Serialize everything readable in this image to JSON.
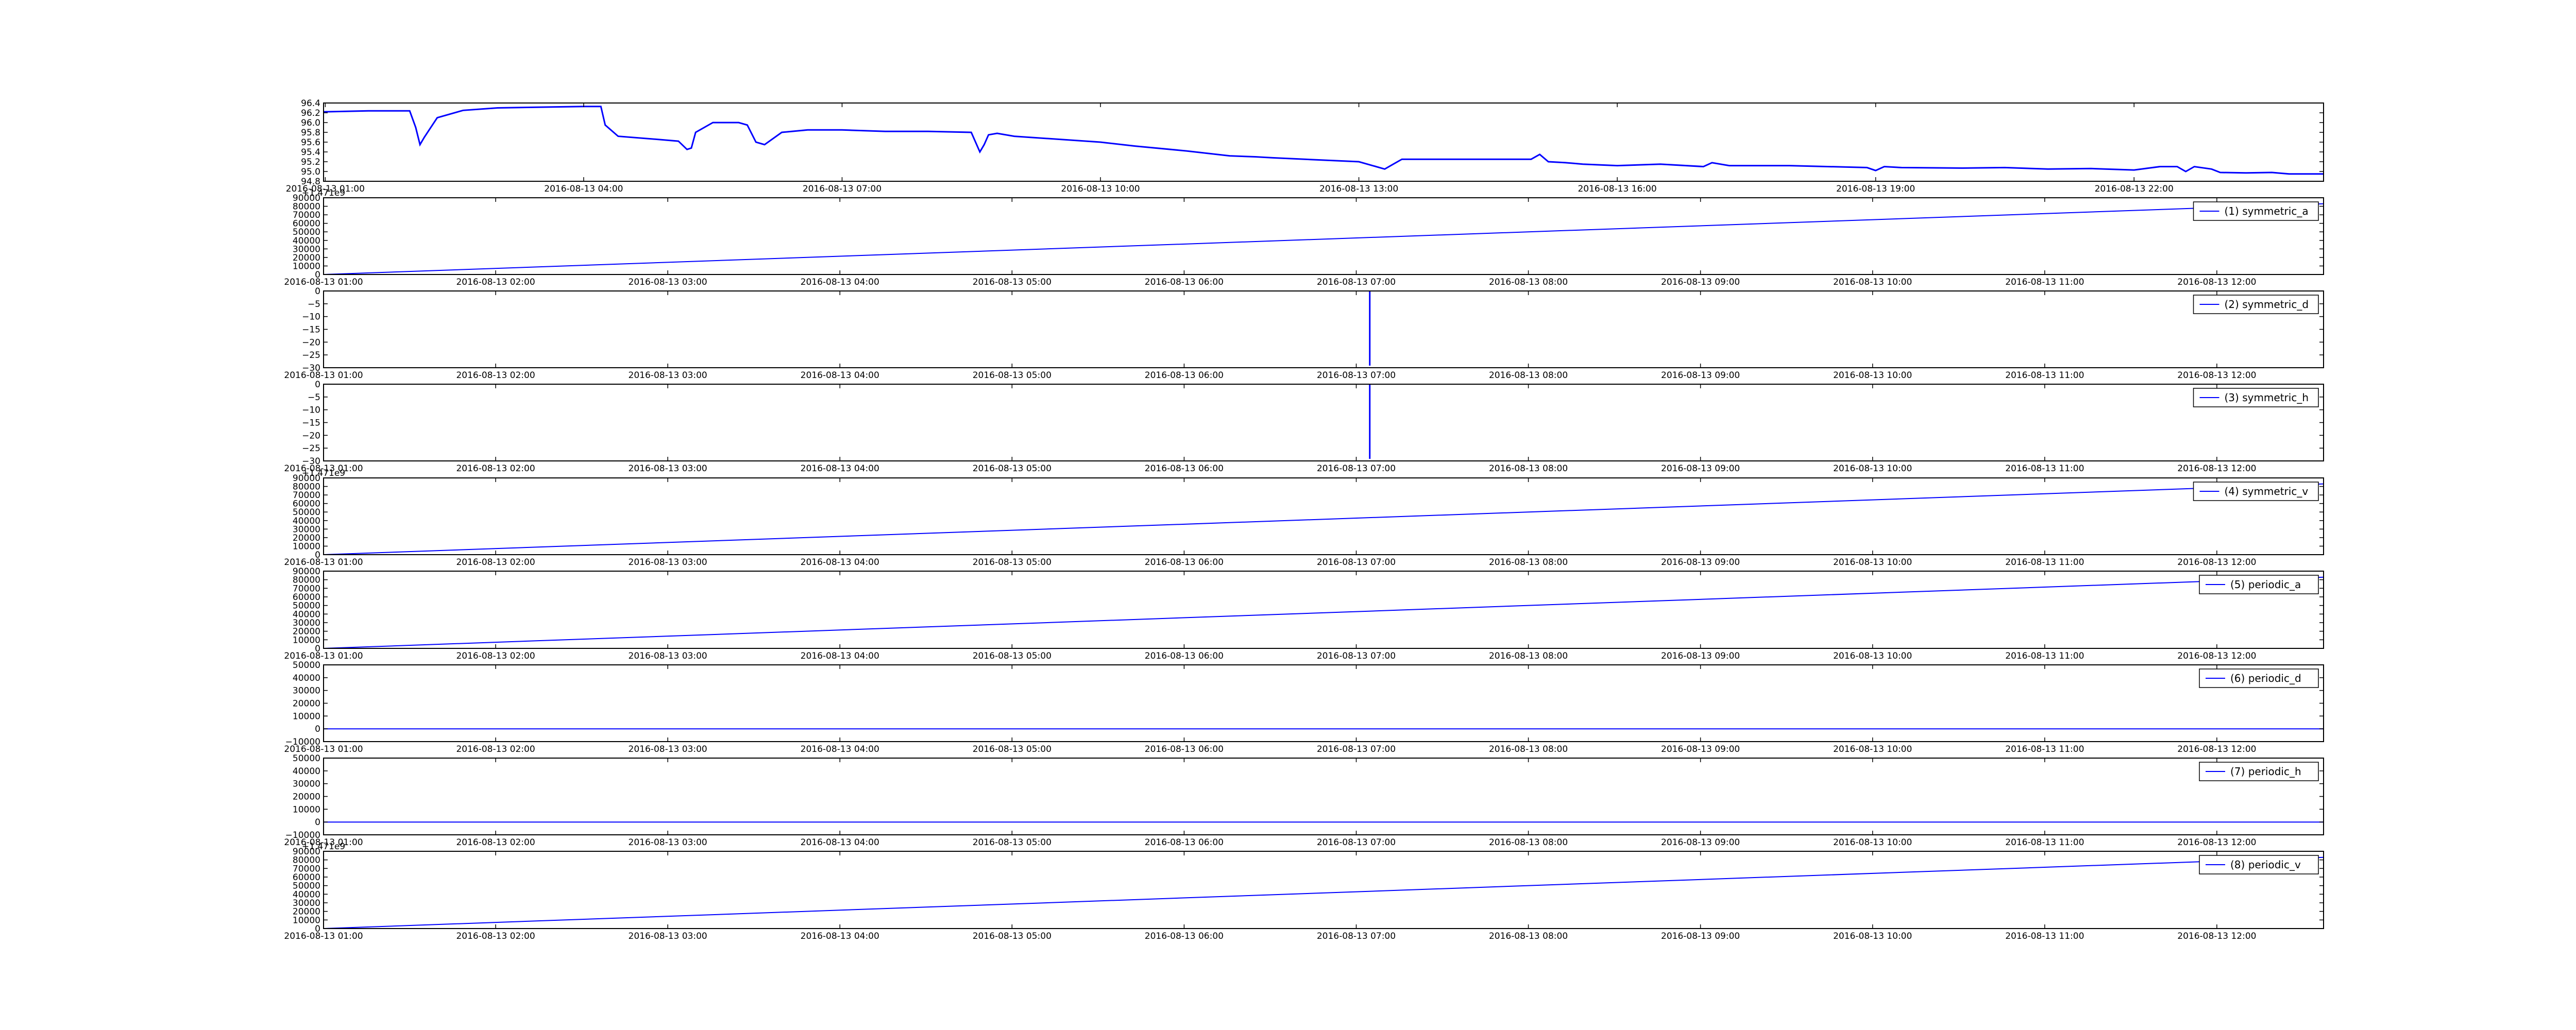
{
  "figure": {
    "background": "#ffffff",
    "line_color": "#0000ff",
    "axis_color": "#000000"
  },
  "chart_data": [
    {
      "type": "line",
      "title": "",
      "xlabel": "",
      "ylabel": "",
      "x_ticks": [
        "2016-08-13 01:00",
        "2016-08-13 04:00",
        "2016-08-13 07:00",
        "2016-08-13 10:00",
        "2016-08-13 13:00",
        "2016-08-13 16:00",
        "2016-08-13 19:00",
        "2016-08-13 22:00"
      ],
      "x_tick_values": [
        1,
        4,
        7,
        10,
        13,
        16,
        19,
        22
      ],
      "xlim": [
        0.98,
        24.2
      ],
      "ylim": [
        94.8,
        96.4
      ],
      "y_ticks": [
        "94.8",
        "95.0",
        "95.2",
        "95.4",
        "95.6",
        "95.8",
        "96.0",
        "96.2",
        "96.4"
      ],
      "y_tick_values": [
        94.8,
        95.0,
        95.2,
        95.4,
        95.6,
        95.8,
        96.0,
        96.2,
        96.4
      ],
      "legend": null,
      "series": [
        {
          "x": [
            0.98,
            1.5,
            1.98,
            2.05,
            2.1,
            2.15,
            2.3,
            2.6,
            3.0,
            4.0,
            4.2,
            4.25,
            4.4,
            4.9,
            5.1,
            5.2,
            5.25,
            5.3,
            5.5,
            5.8,
            5.9,
            6.0,
            6.1,
            6.3,
            6.6,
            7.0,
            7.5,
            8.0,
            8.5,
            8.6,
            8.65,
            8.7,
            8.8,
            9.0,
            10.0,
            10.4,
            11.0,
            11.5,
            11.8,
            12.0,
            13.0,
            13.2,
            13.3,
            13.4,
            13.5,
            13.7,
            14.0,
            14.5,
            15.0,
            15.1,
            15.2,
            15.4,
            15.6,
            16.0,
            16.5,
            17.0,
            17.1,
            17.3,
            18.0,
            18.9,
            19.0,
            19.1,
            19.3,
            20.0,
            20.5,
            21.0,
            21.5,
            22.0,
            22.3,
            22.5,
            22.6,
            22.7,
            22.9,
            23.0,
            23.3,
            23.6,
            23.8,
            24.0,
            24.2
          ],
          "values": [
            96.22,
            96.24,
            96.24,
            95.9,
            95.55,
            95.7,
            96.1,
            96.25,
            96.3,
            96.33,
            96.33,
            95.95,
            95.72,
            95.65,
            95.62,
            95.45,
            95.48,
            95.8,
            96.0,
            96.0,
            95.95,
            95.6,
            95.55,
            95.8,
            95.85,
            95.85,
            95.82,
            95.82,
            95.8,
            95.4,
            95.55,
            95.75,
            95.78,
            95.72,
            95.6,
            95.52,
            95.42,
            95.32,
            95.3,
            95.28,
            95.2,
            95.1,
            95.05,
            95.15,
            95.25,
            95.25,
            95.25,
            95.25,
            95.25,
            95.35,
            95.2,
            95.18,
            95.15,
            95.12,
            95.15,
            95.1,
            95.18,
            95.12,
            95.12,
            95.08,
            95.02,
            95.1,
            95.08,
            95.07,
            95.08,
            95.05,
            95.06,
            95.03,
            95.1,
            95.1,
            95.0,
            95.1,
            95.05,
            94.98,
            94.97,
            94.98,
            94.95,
            94.95,
            94.95
          ]
        }
      ]
    },
    {
      "type": "line",
      "x_ticks": [
        "2016-08-13 01:00",
        "2016-08-13 02:00",
        "2016-08-13 03:00",
        "2016-08-13 04:00",
        "2016-08-13 05:00",
        "2016-08-13 06:00",
        "2016-08-13 07:00",
        "2016-08-13 08:00",
        "2016-08-13 09:00",
        "2016-08-13 10:00",
        "2016-08-13 11:00",
        "2016-08-13 12:00"
      ],
      "x_tick_values": [
        1,
        2,
        3,
        4,
        5,
        6,
        7,
        8,
        9,
        10,
        11,
        12
      ],
      "xlim": [
        1.0,
        12.62
      ],
      "ylim": [
        0,
        90000
      ],
      "y_ticks": [
        "0",
        "10000",
        "20000",
        "30000",
        "40000",
        "50000",
        "60000",
        "70000",
        "80000",
        "90000"
      ],
      "y_tick_values": [
        0,
        10000,
        20000,
        30000,
        40000,
        50000,
        60000,
        70000,
        80000,
        90000
      ],
      "offset_text": "+1.471e9",
      "legend": {
        "labels": [
          "(1) symmetric_a"
        ],
        "position": "top-right"
      },
      "series": [
        {
          "name": "(1) symmetric_a",
          "x": [
            1.0,
            12.62
          ],
          "values": [
            0,
            83000
          ]
        }
      ]
    },
    {
      "type": "line",
      "x_ticks": [
        "2016-08-13 01:00",
        "2016-08-13 02:00",
        "2016-08-13 03:00",
        "2016-08-13 04:00",
        "2016-08-13 05:00",
        "2016-08-13 06:00",
        "2016-08-13 07:00",
        "2016-08-13 08:00",
        "2016-08-13 09:00",
        "2016-08-13 10:00",
        "2016-08-13 11:00",
        "2016-08-13 12:00"
      ],
      "x_tick_values": [
        1,
        2,
        3,
        4,
        5,
        6,
        7,
        8,
        9,
        10,
        11,
        12
      ],
      "xlim": [
        1.0,
        12.62
      ],
      "ylim": [
        -30,
        0
      ],
      "y_ticks": [
        "0",
        "−5",
        "−10",
        "−15",
        "−20",
        "−25",
        "−30"
      ],
      "y_tick_values": [
        0,
        -5,
        -10,
        -15,
        -20,
        -25,
        -30
      ],
      "offset_text": "",
      "legend": {
        "labels": [
          "(2) symmetric_d"
        ],
        "position": "top-right"
      },
      "series": [
        {
          "name": "(2) symmetric_d",
          "x": [
            1.0,
            7.077,
            7.077,
            7.08,
            7.08,
            12.62
          ],
          "values": [
            0,
            0,
            -29,
            -29,
            0,
            0
          ]
        }
      ]
    },
    {
      "type": "line",
      "x_ticks": [
        "2016-08-13 01:00",
        "2016-08-13 02:00",
        "2016-08-13 03:00",
        "2016-08-13 04:00",
        "2016-08-13 05:00",
        "2016-08-13 06:00",
        "2016-08-13 07:00",
        "2016-08-13 08:00",
        "2016-08-13 09:00",
        "2016-08-13 10:00",
        "2016-08-13 11:00",
        "2016-08-13 12:00"
      ],
      "x_tick_values": [
        1,
        2,
        3,
        4,
        5,
        6,
        7,
        8,
        9,
        10,
        11,
        12
      ],
      "xlim": [
        1.0,
        12.62
      ],
      "ylim": [
        -30,
        0
      ],
      "y_ticks": [
        "0",
        "−5",
        "−10",
        "−15",
        "−20",
        "−25",
        "−30"
      ],
      "y_tick_values": [
        0,
        -5,
        -10,
        -15,
        -20,
        -25,
        -30
      ],
      "offset_text": "",
      "legend": {
        "labels": [
          "(3) symmetric_h"
        ],
        "position": "top-right"
      },
      "series": [
        {
          "name": "(3) symmetric_h",
          "x": [
            1.0,
            7.077,
            7.077,
            7.08,
            7.08,
            12.62
          ],
          "values": [
            0,
            0,
            -29,
            -29,
            0,
            0
          ]
        }
      ]
    },
    {
      "type": "line",
      "x_ticks": [
        "2016-08-13 01:00",
        "2016-08-13 02:00",
        "2016-08-13 03:00",
        "2016-08-13 04:00",
        "2016-08-13 05:00",
        "2016-08-13 06:00",
        "2016-08-13 07:00",
        "2016-08-13 08:00",
        "2016-08-13 09:00",
        "2016-08-13 10:00",
        "2016-08-13 11:00",
        "2016-08-13 12:00"
      ],
      "x_tick_values": [
        1,
        2,
        3,
        4,
        5,
        6,
        7,
        8,
        9,
        10,
        11,
        12
      ],
      "xlim": [
        1.0,
        12.62
      ],
      "ylim": [
        0,
        90000
      ],
      "y_ticks": [
        "0",
        "10000",
        "20000",
        "30000",
        "40000",
        "50000",
        "60000",
        "70000",
        "80000",
        "90000"
      ],
      "y_tick_values": [
        0,
        10000,
        20000,
        30000,
        40000,
        50000,
        60000,
        70000,
        80000,
        90000
      ],
      "offset_text": "+1.471e9",
      "legend": {
        "labels": [
          "(4) symmetric_v"
        ],
        "position": "top-right"
      },
      "series": [
        {
          "name": "(4) symmetric_v",
          "x": [
            1.0,
            12.62
          ],
          "values": [
            0,
            83000
          ]
        }
      ]
    },
    {
      "type": "line",
      "x_ticks": [
        "2016-08-13 01:00",
        "2016-08-13 02:00",
        "2016-08-13 03:00",
        "2016-08-13 04:00",
        "2016-08-13 05:00",
        "2016-08-13 06:00",
        "2016-08-13 07:00",
        "2016-08-13 08:00",
        "2016-08-13 09:00",
        "2016-08-13 10:00",
        "2016-08-13 11:00",
        "2016-08-13 12:00"
      ],
      "x_tick_values": [
        1,
        2,
        3,
        4,
        5,
        6,
        7,
        8,
        9,
        10,
        11,
        12
      ],
      "xlim": [
        1.0,
        12.62
      ],
      "ylim": [
        0,
        90000
      ],
      "y_ticks": [
        "0",
        "10000",
        "20000",
        "30000",
        "40000",
        "50000",
        "60000",
        "70000",
        "80000",
        "90000"
      ],
      "y_tick_values": [
        0,
        10000,
        20000,
        30000,
        40000,
        50000,
        60000,
        70000,
        80000,
        90000
      ],
      "offset_text": "",
      "legend": {
        "labels": [
          "(5) periodic_a"
        ],
        "position": "top-right"
      },
      "series": [
        {
          "name": "(5) periodic_a",
          "x": [
            1.0,
            12.62
          ],
          "values": [
            0,
            83000
          ]
        }
      ]
    },
    {
      "type": "line",
      "x_ticks": [
        "2016-08-13 01:00",
        "2016-08-13 02:00",
        "2016-08-13 03:00",
        "2016-08-13 04:00",
        "2016-08-13 05:00",
        "2016-08-13 06:00",
        "2016-08-13 07:00",
        "2016-08-13 08:00",
        "2016-08-13 09:00",
        "2016-08-13 10:00",
        "2016-08-13 11:00",
        "2016-08-13 12:00"
      ],
      "x_tick_values": [
        1,
        2,
        3,
        4,
        5,
        6,
        7,
        8,
        9,
        10,
        11,
        12
      ],
      "xlim": [
        1.0,
        12.62
      ],
      "ylim": [
        -10000,
        50000
      ],
      "y_ticks": [
        "−10000",
        "0",
        "10000",
        "20000",
        "30000",
        "40000",
        "50000"
      ],
      "y_tick_values": [
        -10000,
        0,
        10000,
        20000,
        30000,
        40000,
        50000
      ],
      "offset_text": "",
      "legend": {
        "labels": [
          "(6) periodic_d"
        ],
        "position": "top-right"
      },
      "series": [
        {
          "name": "(6) periodic_d",
          "x": [
            1.0,
            12.62
          ],
          "values": [
            0,
            0
          ]
        }
      ]
    },
    {
      "type": "line",
      "x_ticks": [
        "2016-08-13 01:00",
        "2016-08-13 02:00",
        "2016-08-13 03:00",
        "2016-08-13 04:00",
        "2016-08-13 05:00",
        "2016-08-13 06:00",
        "2016-08-13 07:00",
        "2016-08-13 08:00",
        "2016-08-13 09:00",
        "2016-08-13 10:00",
        "2016-08-13 11:00",
        "2016-08-13 12:00"
      ],
      "x_tick_values": [
        1,
        2,
        3,
        4,
        5,
        6,
        7,
        8,
        9,
        10,
        11,
        12
      ],
      "xlim": [
        1.0,
        12.62
      ],
      "ylim": [
        -10000,
        50000
      ],
      "y_ticks": [
        "−10000",
        "0",
        "10000",
        "20000",
        "30000",
        "40000",
        "50000"
      ],
      "y_tick_values": [
        -10000,
        0,
        10000,
        20000,
        30000,
        40000,
        50000
      ],
      "offset_text": "",
      "legend": {
        "labels": [
          "(7) periodic_h"
        ],
        "position": "top-right"
      },
      "series": [
        {
          "name": "(7) periodic_h",
          "x": [
            1.0,
            12.62
          ],
          "values": [
            0,
            0
          ]
        }
      ]
    },
    {
      "type": "line",
      "x_ticks": [
        "2016-08-13 01:00",
        "2016-08-13 02:00",
        "2016-08-13 03:00",
        "2016-08-13 04:00",
        "2016-08-13 05:00",
        "2016-08-13 06:00",
        "2016-08-13 07:00",
        "2016-08-13 08:00",
        "2016-08-13 09:00",
        "2016-08-13 10:00",
        "2016-08-13 11:00",
        "2016-08-13 12:00"
      ],
      "x_tick_values": [
        1,
        2,
        3,
        4,
        5,
        6,
        7,
        8,
        9,
        10,
        11,
        12
      ],
      "xlim": [
        1.0,
        12.62
      ],
      "ylim": [
        0,
        90000
      ],
      "y_ticks": [
        "0",
        "10000",
        "20000",
        "30000",
        "40000",
        "50000",
        "60000",
        "70000",
        "80000",
        "90000"
      ],
      "y_tick_values": [
        0,
        10000,
        20000,
        30000,
        40000,
        50000,
        60000,
        70000,
        80000,
        90000
      ],
      "offset_text": "+1.471e9",
      "legend": {
        "labels": [
          "(8) periodic_v"
        ],
        "position": "top-right"
      },
      "series": [
        {
          "name": "(8) periodic_v",
          "x": [
            1.0,
            12.62
          ],
          "values": [
            0,
            83000
          ]
        }
      ]
    }
  ]
}
